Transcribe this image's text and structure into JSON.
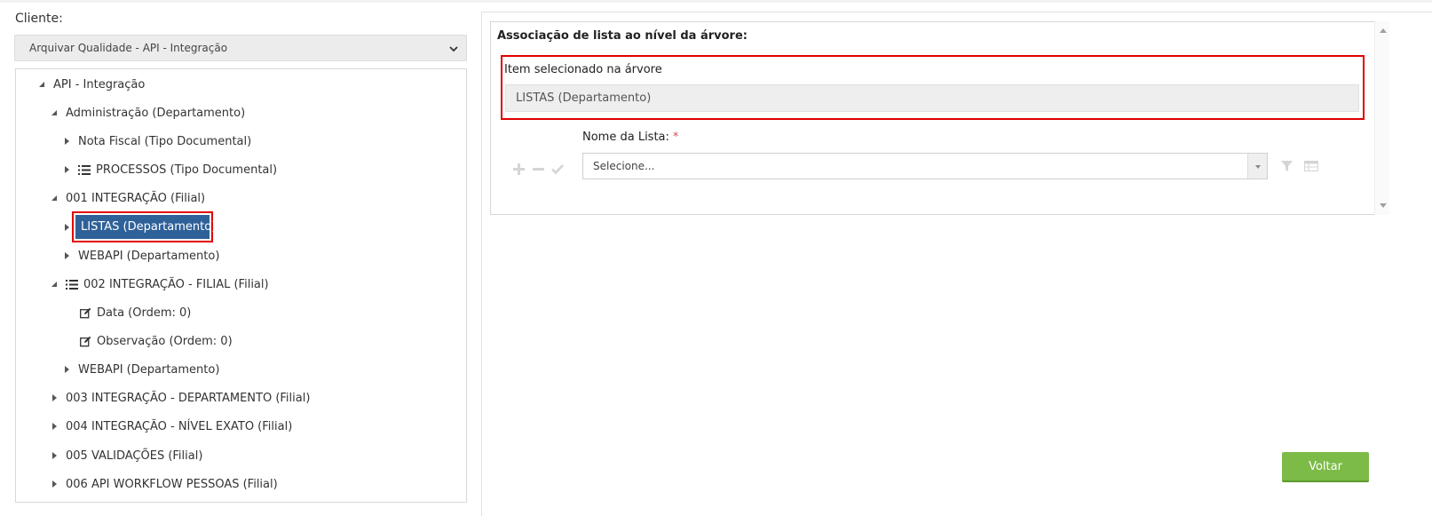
{
  "cliente": {
    "label": "Cliente:",
    "selected": "Arquivar Qualidade - API - Integração"
  },
  "tree": {
    "nodes": [
      {
        "label": "API - Integração",
        "state": "expanded"
      },
      {
        "label": "Administração (Departamento)",
        "state": "expanded"
      },
      {
        "label": "Nota Fiscal (Tipo Documental)",
        "state": "collapsed"
      },
      {
        "label": "PROCESSOS (Tipo Documental)",
        "state": "collapsed",
        "icon": "list-icon"
      },
      {
        "label": "001 INTEGRAÇÃO (Filial)",
        "state": "expanded"
      },
      {
        "label": "LISTAS (Departamento)",
        "state": "collapsed",
        "selected": true
      },
      {
        "label": "WEBAPI (Departamento)",
        "state": "collapsed"
      },
      {
        "label": "002 INTEGRAÇÃO - FILIAL (Filial)",
        "state": "expanded",
        "icon": "list-icon"
      },
      {
        "label": "Data (Ordem: 0)",
        "state": "leaf",
        "icon": "edit-icon"
      },
      {
        "label": "Observação (Ordem: 0)",
        "state": "leaf",
        "icon": "edit-icon"
      },
      {
        "label": "WEBAPI (Departamento)",
        "state": "collapsed"
      },
      {
        "label": "003 INTEGRAÇÃO - DEPARTAMENTO (Filial)",
        "state": "collapsed"
      },
      {
        "label": "004 INTEGRAÇÃO - NÍVEL EXATO (Filial)",
        "state": "collapsed"
      },
      {
        "label": "005 VALIDAÇÕES (Filial)",
        "state": "collapsed"
      },
      {
        "label": "006 API WORKFLOW PESSOAS (Filial)",
        "state": "collapsed"
      }
    ]
  },
  "panel": {
    "title": "Associação de lista ao nível da árvore:",
    "selected_item_label": "Item selecionado na árvore",
    "selected_item_value": "LISTAS (Departamento)",
    "list_name_label": "Nome da Lista:",
    "required_mark": "*",
    "list_select_placeholder": "Selecione...",
    "back_button": "Voltar"
  },
  "colors": {
    "selected_node_bg": "#2f6199",
    "highlight_border": "#e10000",
    "back_button_bg": "#7dbb48"
  }
}
